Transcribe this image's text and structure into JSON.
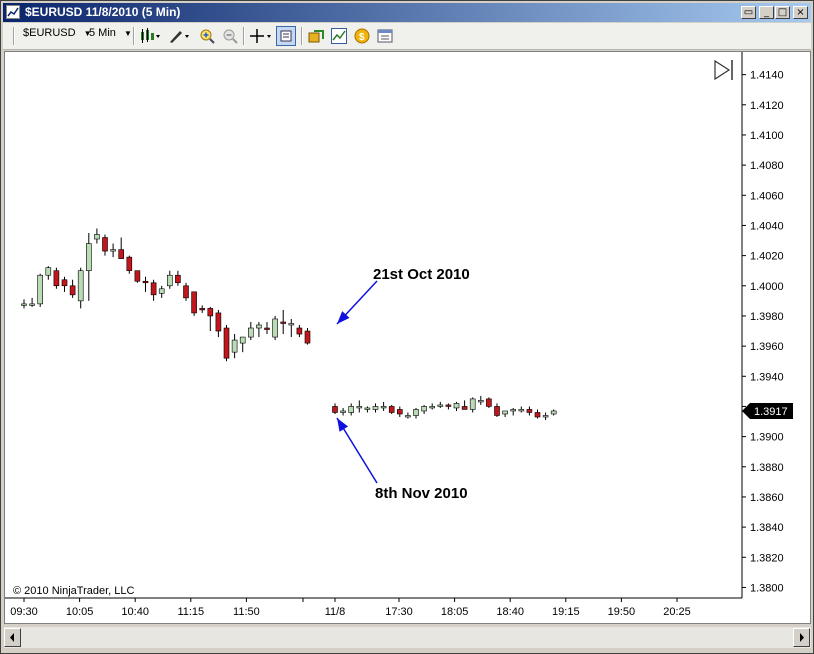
{
  "window": {
    "title": "$EURUSD  11/8/2010 (5 Min)",
    "controls": {
      "restore": "▭",
      "minimize": "_",
      "maximize": "□",
      "close": "×"
    }
  },
  "toolbar": {
    "instrument": "$EURUSD",
    "interval": "5 Min",
    "icons": [
      "chart-style-icon",
      "drawing-tool-icon",
      "zoom-in-icon",
      "zoom-out-icon",
      "crosshair-icon",
      "data-box-icon",
      "strategies-icon",
      "indicators-icon",
      "currency-icon",
      "properties-icon"
    ]
  },
  "colors": {
    "up": "#b9dcb4",
    "down": "#c1161b",
    "annotation": "#1010e0",
    "price_tag": "#000000"
  },
  "chart_data": {
    "type": "candlestick",
    "title": "",
    "copyright": "© 2010 NinjaTrader, LLC",
    "price_axis": {
      "ylim": [
        1.3793,
        1.4155
      ],
      "ticks": [
        "1.4140",
        "1.4120",
        "1.4100",
        "1.4080",
        "1.4060",
        "1.4040",
        "1.4020",
        "1.4000",
        "1.3980",
        "1.3960",
        "1.3940",
        "1.3920",
        "1.3900",
        "1.3880",
        "1.3860",
        "1.3840",
        "1.3820",
        "1.3800"
      ],
      "current_price": "1.3917"
    },
    "time_axis": {
      "ticks": [
        "09:30",
        "10:05",
        "10:40",
        "11:15",
        "11:50",
        "11/8",
        "17:30",
        "18:05",
        "18:40",
        "19:15",
        "19:50",
        "20:25"
      ]
    },
    "annotations": [
      {
        "text": "21st Oct 2010",
        "points_to": "last bar of 21 Oct session"
      },
      {
        "text": "8th Nov 2010",
        "points_to": "first bar of 8 Nov session"
      }
    ],
    "sessions": [
      {
        "name": "21 Oct 2010",
        "bars": [
          [
            1.3988,
            1.3991,
            1.3985,
            1.3988
          ],
          [
            1.3988,
            1.3992,
            1.3986,
            1.3988
          ],
          [
            1.3988,
            1.4008,
            1.3986,
            1.4007
          ],
          [
            1.4007,
            1.4013,
            1.4004,
            1.4012
          ],
          [
            1.401,
            1.4012,
            1.3998,
            1.4
          ],
          [
            1.4004,
            1.4006,
            1.3996,
            1.4
          ],
          [
            1.4,
            1.4004,
            1.3992,
            1.3994
          ],
          [
            1.399,
            1.4012,
            1.3985,
            1.401
          ],
          [
            1.401,
            1.4035,
            1.399,
            1.4028
          ],
          [
            1.4031,
            1.4038,
            1.4028,
            1.4034
          ],
          [
            1.4032,
            1.4034,
            1.402,
            1.4023
          ],
          [
            1.4024,
            1.4028,
            1.4019,
            1.4024
          ],
          [
            1.4024,
            1.4032,
            1.4018,
            1.4018
          ],
          [
            1.4019,
            1.402,
            1.4008,
            1.401
          ],
          [
            1.401,
            1.401,
            1.4002,
            1.4003
          ],
          [
            1.4003,
            1.4006,
            1.3996,
            1.4002
          ],
          [
            1.4002,
            1.4004,
            1.399,
            1.3994
          ],
          [
            1.3995,
            1.4,
            1.3992,
            1.3998
          ],
          [
            1.4,
            1.401,
            1.3998,
            1.4007
          ],
          [
            1.4007,
            1.401,
            1.4,
            1.4002
          ],
          [
            1.4,
            1.4002,
            1.399,
            1.3992
          ],
          [
            1.3996,
            1.3996,
            1.398,
            1.3982
          ],
          [
            1.3985,
            1.3987,
            1.3982,
            1.3984
          ],
          [
            1.3985,
            1.3986,
            1.397,
            1.398
          ],
          [
            1.3982,
            1.3984,
            1.3966,
            1.397
          ],
          [
            1.3972,
            1.3974,
            1.395,
            1.3952
          ],
          [
            1.3956,
            1.3968,
            1.3952,
            1.3964
          ],
          [
            1.3962,
            1.3966,
            1.3956,
            1.3966
          ],
          [
            1.3966,
            1.3976,
            1.3964,
            1.3972
          ],
          [
            1.3972,
            1.3976,
            1.3966,
            1.3974
          ],
          [
            1.3972,
            1.3976,
            1.3968,
            1.3971
          ],
          [
            1.3966,
            1.398,
            1.3964,
            1.3978
          ],
          [
            1.3976,
            1.3984,
            1.3968,
            1.3975
          ],
          [
            1.3975,
            1.3978,
            1.3966,
            1.3975
          ],
          [
            1.3972,
            1.3974,
            1.3966,
            1.3968
          ],
          [
            1.397,
            1.3972,
            1.3961,
            1.3962
          ]
        ]
      },
      {
        "name": "8 Nov 2010",
        "bars": [
          [
            1.392,
            1.3922,
            1.3915,
            1.3916
          ],
          [
            1.3917,
            1.3919,
            1.3914,
            1.3917
          ],
          [
            1.3916,
            1.3922,
            1.3914,
            1.392
          ],
          [
            1.3919,
            1.3924,
            1.3916,
            1.392
          ],
          [
            1.3918,
            1.392,
            1.3916,
            1.3919
          ],
          [
            1.3918,
            1.3922,
            1.3916,
            1.392
          ],
          [
            1.392,
            1.3923,
            1.3917,
            1.392
          ],
          [
            1.392,
            1.3921,
            1.3915,
            1.3916
          ],
          [
            1.3918,
            1.392,
            1.3913,
            1.3915
          ],
          [
            1.3914,
            1.3916,
            1.3912,
            1.3914
          ],
          [
            1.3914,
            1.3919,
            1.3912,
            1.3918
          ],
          [
            1.3917,
            1.3921,
            1.3915,
            1.392
          ],
          [
            1.392,
            1.3922,
            1.3918,
            1.392
          ],
          [
            1.3921,
            1.3923,
            1.3919,
            1.3921
          ],
          [
            1.3921,
            1.3922,
            1.3918,
            1.392
          ],
          [
            1.3919,
            1.3923,
            1.3917,
            1.3922
          ],
          [
            1.392,
            1.3924,
            1.3918,
            1.3918
          ],
          [
            1.3918,
            1.3926,
            1.3916,
            1.3925
          ],
          [
            1.3923,
            1.3927,
            1.3921,
            1.3924
          ],
          [
            1.3925,
            1.3926,
            1.3919,
            1.392
          ],
          [
            1.392,
            1.3922,
            1.3913,
            1.3914
          ],
          [
            1.3915,
            1.3917,
            1.3913,
            1.3917
          ],
          [
            1.3917,
            1.3919,
            1.3914,
            1.3918
          ],
          [
            1.3918,
            1.392,
            1.3916,
            1.3918
          ],
          [
            1.3918,
            1.392,
            1.3914,
            1.3916
          ],
          [
            1.3916,
            1.3918,
            1.3912,
            1.3913
          ],
          [
            1.3914,
            1.3916,
            1.3911,
            1.3914
          ],
          [
            1.3915,
            1.3918,
            1.3914,
            1.3917
          ]
        ]
      }
    ]
  }
}
